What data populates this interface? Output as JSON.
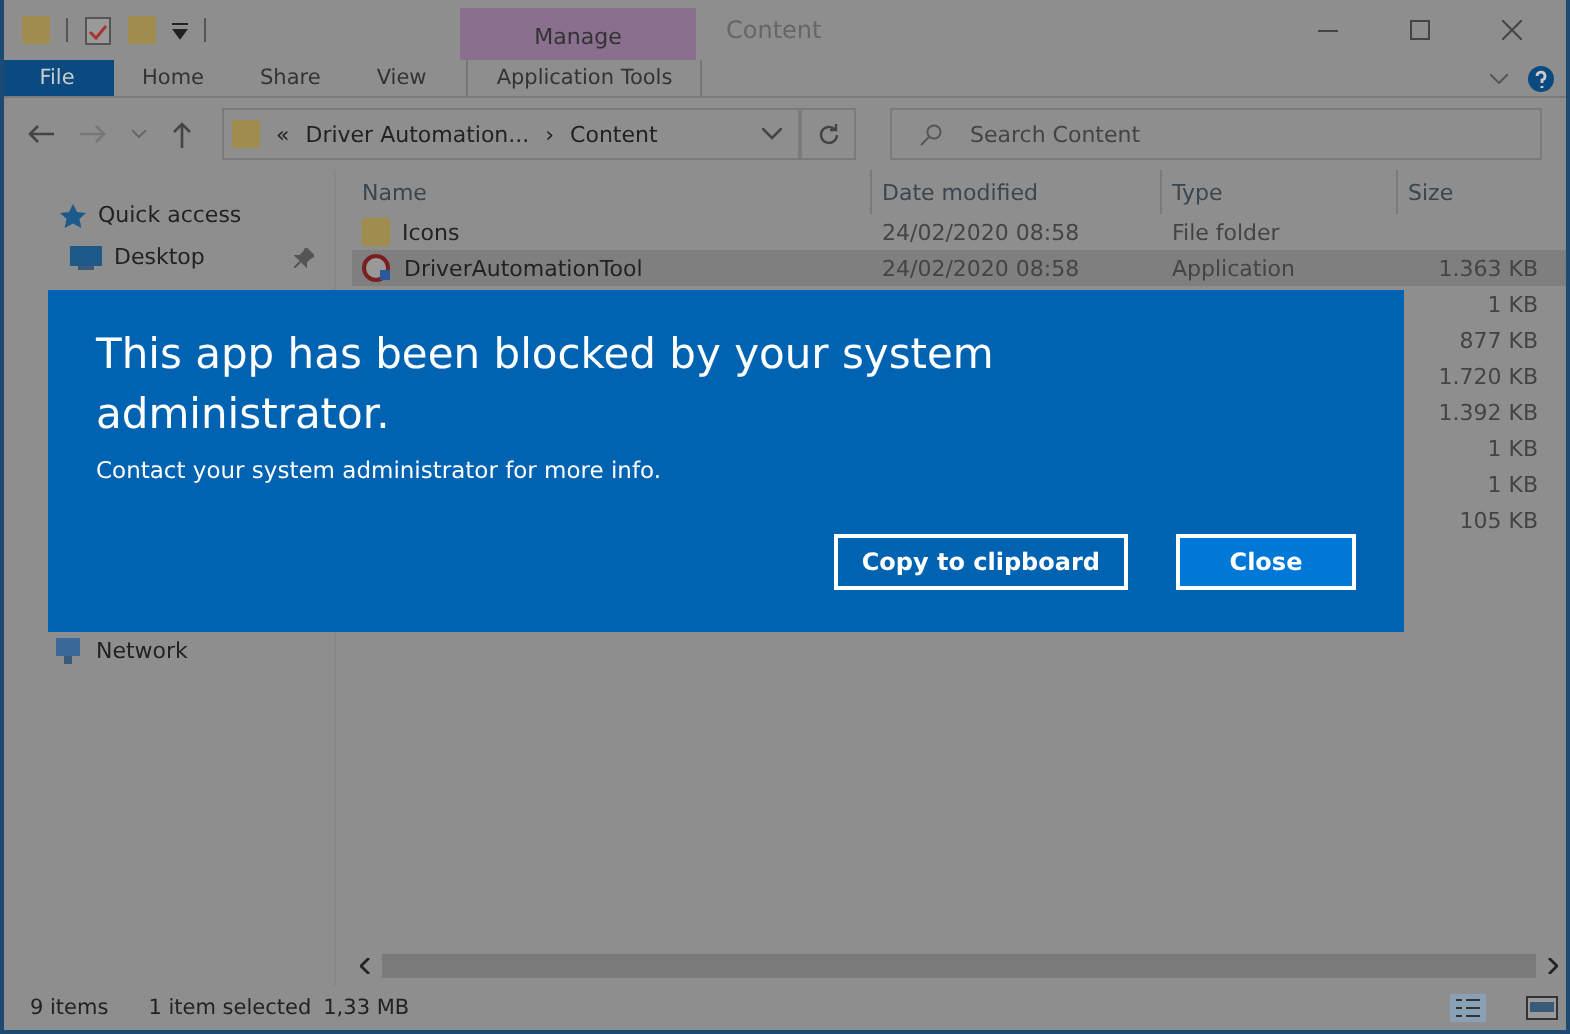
{
  "window": {
    "title": "Content",
    "context_tab": "Manage"
  },
  "ribbon_tabs": [
    {
      "label": "File",
      "kind": "file",
      "selected": false
    },
    {
      "label": "Home",
      "kind": "tab",
      "selected": false
    },
    {
      "label": "Share",
      "kind": "tab",
      "selected": false
    },
    {
      "label": "View",
      "kind": "tab",
      "selected": false
    },
    {
      "label": "Application Tools",
      "kind": "context",
      "selected": false
    }
  ],
  "address": {
    "prefix": "«",
    "parts": [
      "Driver Automation...",
      "Content"
    ],
    "separator": "›"
  },
  "search": {
    "placeholder": "Search Content"
  },
  "sidebar": {
    "items": [
      {
        "label": "Quick access",
        "kind": "star",
        "pinned": false
      },
      {
        "label": "Desktop",
        "kind": "desktop",
        "pinned": true
      },
      {
        "label": "Network",
        "kind": "network",
        "pinned": false
      }
    ]
  },
  "table": {
    "columns": [
      "Name",
      "Date modified",
      "Type",
      "Size"
    ],
    "rows": [
      {
        "name": "Icons",
        "kind": "folder",
        "date": "24/02/2020 08:58",
        "type": "File folder",
        "size": "",
        "selected": false
      },
      {
        "name": "DriverAutomationTool",
        "kind": "app",
        "date": "24/02/2020 08:58",
        "type": "Application",
        "size": "1.363 KB",
        "selected": true
      },
      {
        "size": "1 KB",
        "selected": false
      },
      {
        "size": "877 KB",
        "selected": false
      },
      {
        "size": "1.720 KB",
        "selected": false
      },
      {
        "size": "1.392 KB",
        "selected": false
      },
      {
        "size": "1 KB",
        "selected": false
      },
      {
        "size": "1 KB",
        "selected": false
      },
      {
        "size": "105 KB",
        "selected": false
      }
    ]
  },
  "status_bar": {
    "items": "9 items",
    "selection": "1 item selected",
    "size": "1,33 MB"
  },
  "dialog": {
    "title": "This app has been blocked by your system administrator.",
    "message": "Contact your system administrator for more info.",
    "buttons": [
      {
        "label": "Copy to clipboard",
        "kind": "secondary"
      },
      {
        "label": "Close",
        "kind": "primary"
      }
    ]
  }
}
